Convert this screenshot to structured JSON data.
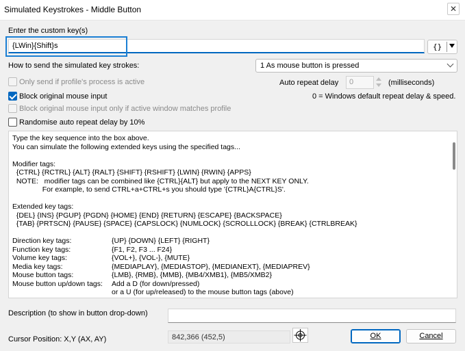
{
  "window": {
    "title": "Simulated Keystrokes - Middle Button",
    "close_glyph": "✕"
  },
  "custom_key": {
    "label": "Enter the custom key(s)",
    "value": "{LWin}{Shift}s",
    "brace_button": "{}"
  },
  "send_mode": {
    "label": "How to send the simulated key strokes:",
    "selected": "1 As mouse button is pressed"
  },
  "options": {
    "only_send_if_active": {
      "label": "Only send if profile's process is active",
      "checked": false,
      "enabled": false
    },
    "block_mouse_input": {
      "label": "Block original mouse input",
      "checked": true,
      "enabled": true
    },
    "block_if_matches": {
      "label": "Block original mouse input only if active window matches profile",
      "checked": false,
      "enabled": false
    },
    "randomise_delay": {
      "label": "Randomise auto repeat delay by 10%",
      "checked": false,
      "enabled": true
    }
  },
  "auto_repeat": {
    "label": "Auto repeat delay",
    "value": "0",
    "unit": "(milliseconds)",
    "note": "0 = Windows default repeat delay & speed."
  },
  "help_lines": [
    {
      "a": "Type the key sequence into the box above."
    },
    {
      "a": "You can simulate the following extended keys using the specified tags..."
    },
    {
      "a": ""
    },
    {
      "a": "Modifier tags:"
    },
    {
      "a": "  {CTRL} {RCTRL} {ALT} {RALT} {SHIFT} {RSHIFT} {LWIN} {RWIN} {APPS}"
    },
    {
      "a": "  NOTE:   modifier tags can be combined like {CTRL}{ALT} but apply to the NEXT KEY ONLY."
    },
    {
      "a": "               For example, to send CTRL+a+CTRL+s you should type '{CTRL}A{CTRL}S'."
    },
    {
      "a": ""
    },
    {
      "a": "Extended key tags:"
    },
    {
      "a": "  {DEL} {INS} {PGUP} {PGDN} {HOME} {END} {RETURN} {ESCAPE} {BACKSPACE}"
    },
    {
      "a": "  {TAB} {PRTSCN} {PAUSE} {SPACE} {CAPSLOCK} {NUMLOCK} {SCROLLLOCK} {BREAK} {CTRLBREAK}"
    },
    {
      "a": ""
    },
    {
      "a": "Direction key tags:",
      "b": "{UP} {DOWN} {LEFT} {RIGHT}"
    },
    {
      "a": "Function key tags:",
      "b": "{F1, F2, F3 ... F24}"
    },
    {
      "a": "Volume key tags:",
      "b": "{VOL+}, {VOL-}, {MUTE}"
    },
    {
      "a": "Media key tags:",
      "b": "{MEDIAPLAY}, {MEDIASTOP}, {MEDIANEXT}, {MEDIAPREV}"
    },
    {
      "a": "Mouse button tags:",
      "b": "{LMB}, {RMB}, {MMB}, {MB4/XMB1}, {MB5/XMB2}"
    },
    {
      "a": "Mouse button up/down tags:",
      "b": "Add a D (for down/pressed)"
    },
    {
      "a": "",
      "b": "or a U (for up/released) to the mouse button tags (above)"
    }
  ],
  "description": {
    "label": "Description (to show in button drop-down)",
    "value": ""
  },
  "cursor": {
    "label": "Cursor Position: X,Y (AX, AY)",
    "value": "842,366 (452,5)"
  },
  "buttons": {
    "ok": "OK",
    "cancel": "Cancel"
  }
}
